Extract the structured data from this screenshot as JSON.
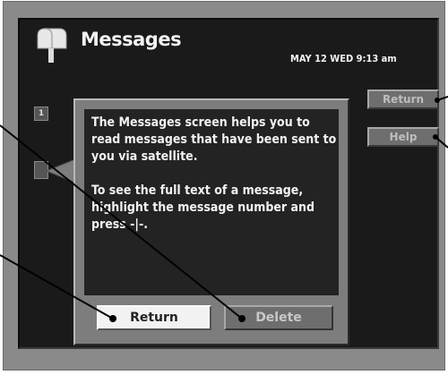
{
  "header": {
    "title": "Messages",
    "datetime": "MAY 12 WED  9:13 am",
    "icon": "mailbox-icon"
  },
  "side_buttons": {
    "return_label": "Return",
    "help_label": "Help"
  },
  "message_list": {
    "first_number": "1"
  },
  "help_panel": {
    "paragraph1": "The Messages screen helps you to read messages that have been sent to you via satellite.",
    "paragraph2": "To see the full text of a message, highlight the message number and press -|-.",
    "return_label": "Return",
    "delete_label": "Delete"
  },
  "colors": {
    "screen_bg": "#1a1a1a",
    "panel_bg": "#7d7d7d",
    "panel_inner_bg": "#232323",
    "highlight_button": "#f2f2f2",
    "text": "#f2f2f2"
  }
}
